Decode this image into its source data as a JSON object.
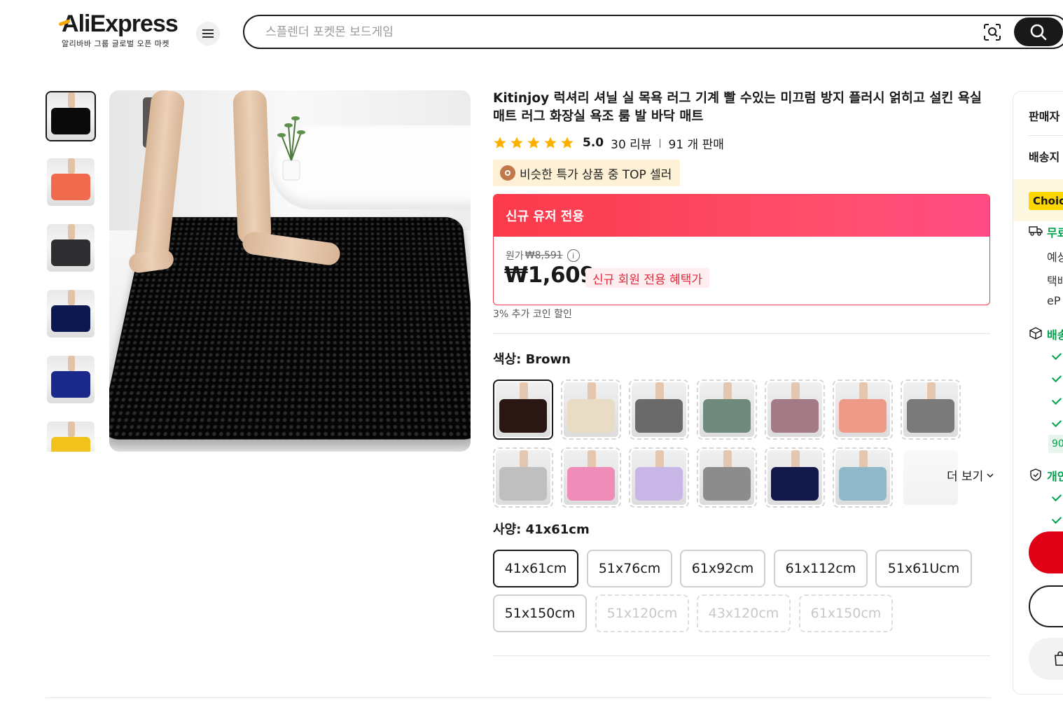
{
  "header": {
    "logo_text": "AliExpress",
    "logo_sub": "알리바바 그룹 글로벌 오픈 마켓",
    "search_placeholder": "스플렌더 포켓몬 보드게임"
  },
  "product": {
    "title": "Kitinjoy 럭셔리 셔닐 실 목욕 러그 기계 빨 수있는 미끄럼 방지 플러시 얽히고 설킨 욕실 매트 러그 화장실 욕조 룸 발 바닥 매트",
    "rating": "5.0",
    "rating_stars": 5,
    "reviews": "30 리뷰",
    "sold": "91 개 판매",
    "top_badge": "비슷한 특가 상품 중 TOP 셀러"
  },
  "promo": {
    "header": "신규 유저 전용",
    "original_label": "원가",
    "original_price": "₩8,591",
    "price": "₩1,609",
    "price_tag": "신규 회원 전용 혜택가",
    "coin_note": "3% 추가 코인 할인"
  },
  "color": {
    "label": "색상: Brown",
    "more": "더 보기",
    "swatches": [
      {
        "color": "#2a1612",
        "active": true
      },
      {
        "color": "#e8dcc4"
      },
      {
        "color": "#6a6a6a"
      },
      {
        "color": "#6f8a7c"
      },
      {
        "color": "#a47a86"
      },
      {
        "color": "#ee9a88"
      },
      {
        "color": "#7a7a7a"
      },
      {
        "color": "#bfbfbf"
      },
      {
        "color": "#ef8cb8"
      },
      {
        "color": "#c7b6e6"
      },
      {
        "color": "#8c8c8c"
      },
      {
        "color": "#12194a"
      },
      {
        "color": "#8fb8c8"
      }
    ]
  },
  "spec": {
    "label": "사양: 41x61cm",
    "sizes": [
      {
        "label": "41x61cm",
        "state": "active"
      },
      {
        "label": "51x76cm",
        "state": "normal"
      },
      {
        "label": "61x92cm",
        "state": "normal"
      },
      {
        "label": "61x112cm",
        "state": "normal"
      },
      {
        "label": "51x61Ucm",
        "state": "normal"
      },
      {
        "label": "51x150cm",
        "state": "normal"
      },
      {
        "label": "51x120cm",
        "state": "disabled"
      },
      {
        "label": "43x120cm",
        "state": "disabled"
      },
      {
        "label": "61x150cm",
        "state": "disabled"
      }
    ]
  },
  "thumbnails": [
    {
      "color": "#0a0a0a",
      "active": true
    },
    {
      "color": "#f06a4e"
    },
    {
      "color": "#2e2e30"
    },
    {
      "color": "#0d1850"
    },
    {
      "color": "#1b2a8a"
    },
    {
      "color": "#f2c21c"
    }
  ],
  "side_panel": {
    "seller": "판매자",
    "ship_to": "배송지",
    "choice": "Choic",
    "free_ship": "무료",
    "est": "예상",
    "courier": "택배",
    "ep": "eP",
    "delivery": "배송",
    "badge_90": "90",
    "privacy": "개인"
  },
  "colors": {
    "accent_red": "#e00015",
    "promo_gradient_start": "#fb3a4a",
    "promo_gradient_end": "#ff4a84",
    "star": "#fdb100",
    "green": "#00a14b",
    "choice_yellow": "#fdd700"
  }
}
